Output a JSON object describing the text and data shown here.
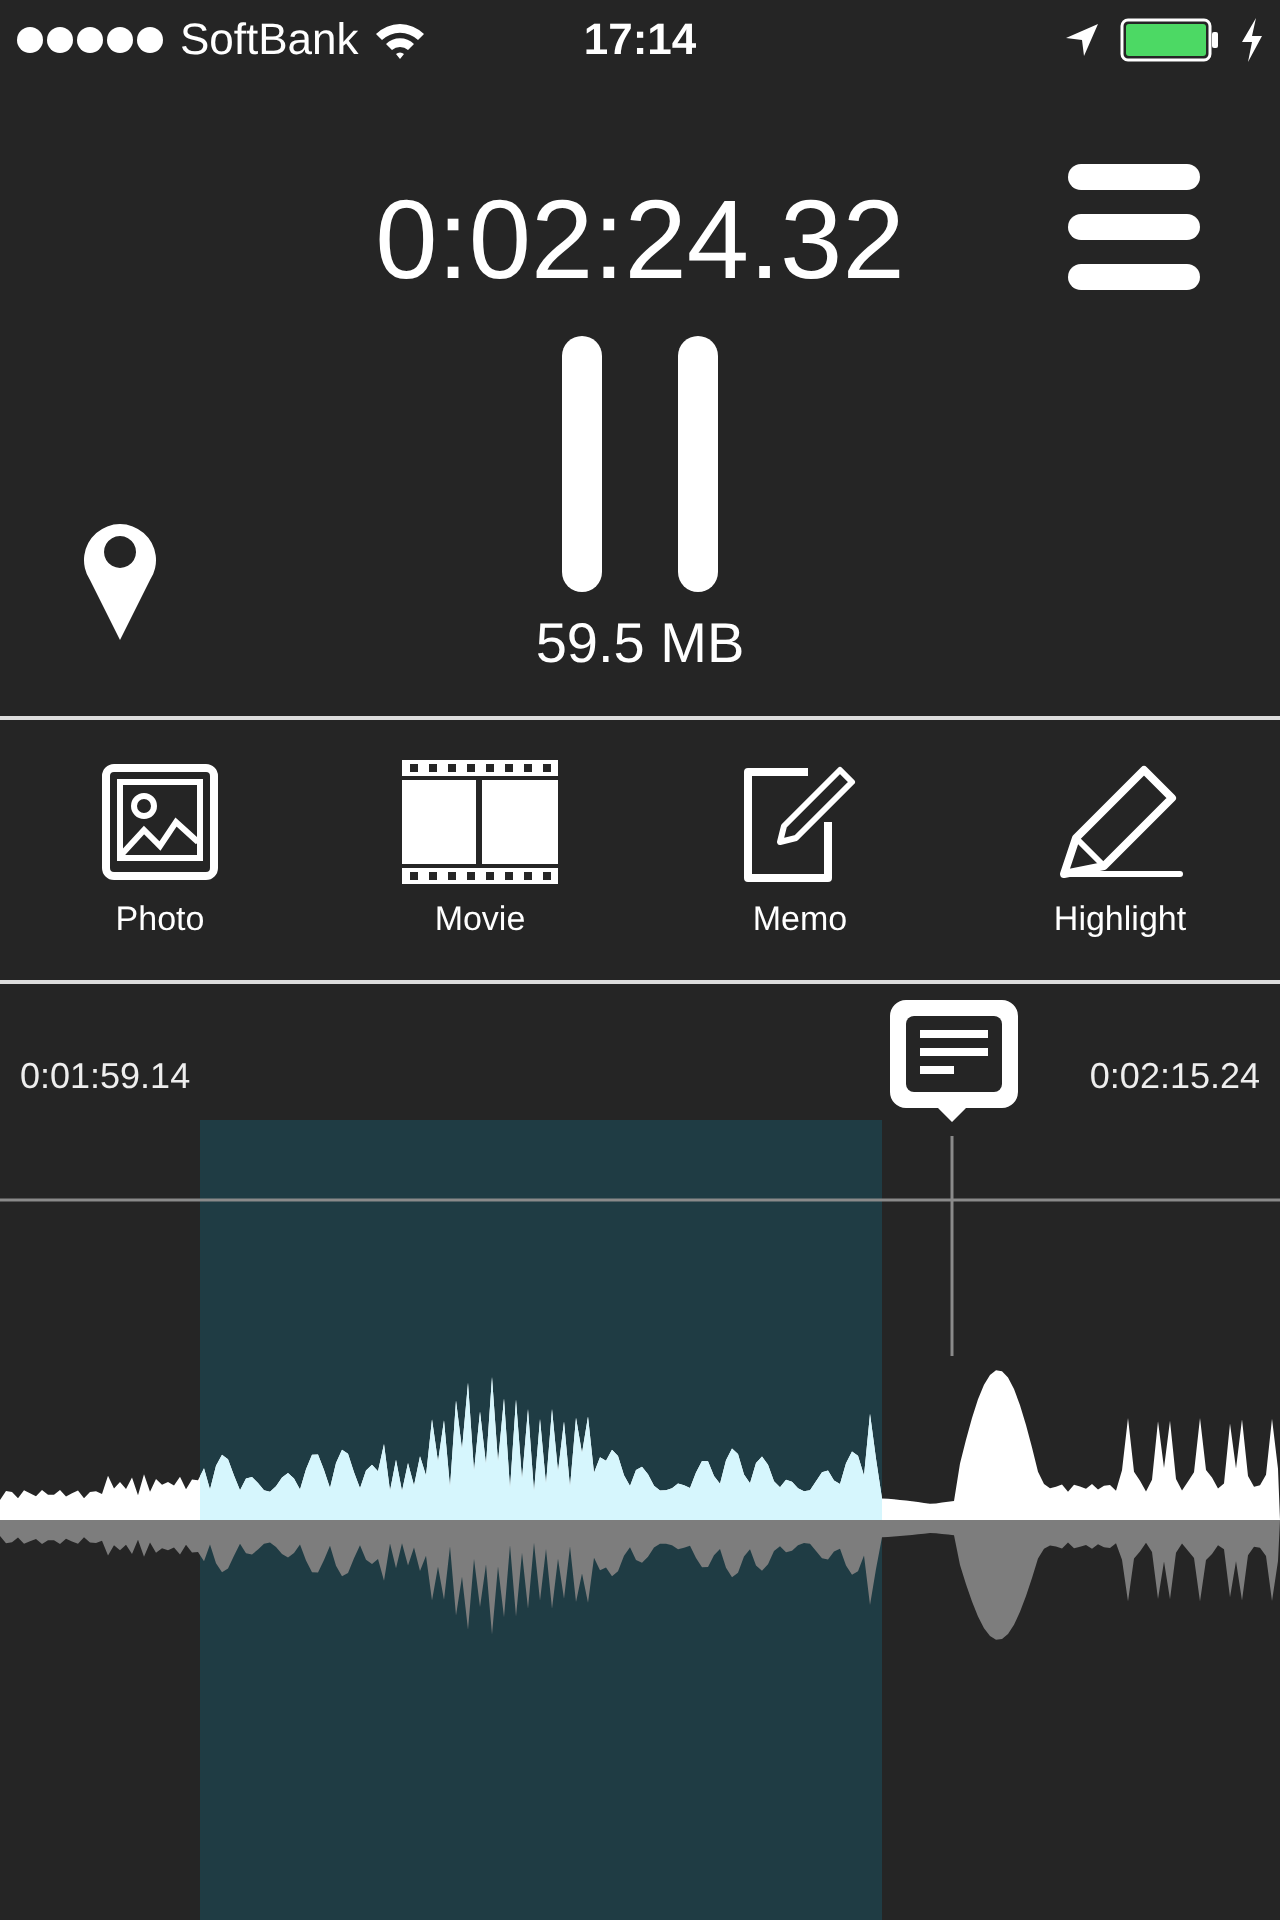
{
  "status_bar": {
    "carrier": "SoftBank",
    "time": "17:14"
  },
  "recorder": {
    "elapsed": "0:02:24.32",
    "size": "59.5 MB"
  },
  "toolbar": [
    {
      "label": "Photo",
      "kind": "photo"
    },
    {
      "label": "Movie",
      "kind": "movie"
    },
    {
      "label": "Memo",
      "kind": "memo"
    },
    {
      "label": "Highlight",
      "kind": "highlight"
    }
  ],
  "timeline": {
    "start": "0:01:59.14",
    "end": "0:02:15.24"
  }
}
